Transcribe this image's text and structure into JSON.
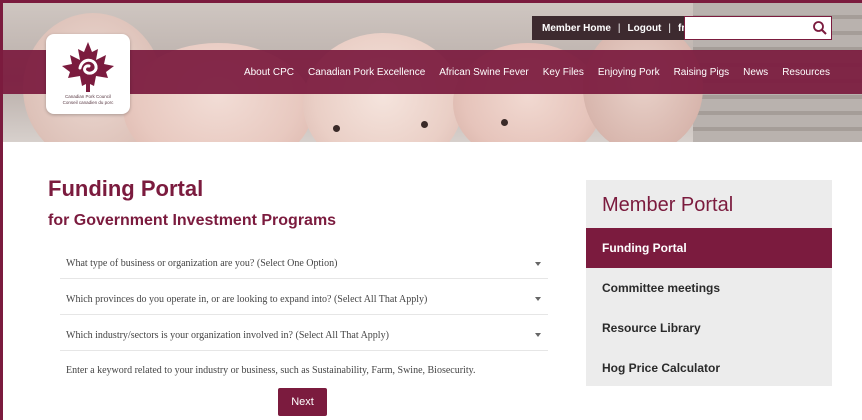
{
  "header": {
    "topbar": {
      "member_home": "Member Home",
      "logout": "Logout",
      "lang": "fr",
      "separator": "|"
    },
    "search": {
      "placeholder": ""
    },
    "logo": {
      "line1": "Canadian Pork Council",
      "line2": "Conseil canadien du porc"
    },
    "nav": [
      {
        "label": "About CPC"
      },
      {
        "label": "Canadian Pork Excellence"
      },
      {
        "label": "African Swine Fever"
      },
      {
        "label": "Key Files"
      },
      {
        "label": "Enjoying Pork"
      },
      {
        "label": "Raising Pigs"
      },
      {
        "label": "News"
      },
      {
        "label": "Resources"
      }
    ]
  },
  "main": {
    "title": "Funding Portal",
    "subtitle": "for Government Investment Programs",
    "questions": [
      {
        "text": "What type of business or organization are you? (Select One Option)"
      },
      {
        "text": "Which provinces do you operate in, or are looking to expand into? (Select All That Apply)"
      },
      {
        "text": "Which industry/sectors is your organization involved in? (Select All That Apply)"
      },
      {
        "text": "Enter a keyword related to your industry or business, such as Sustainability, Farm, Swine, Biosecurity."
      }
    ],
    "next_label": "Next"
  },
  "sidebar": {
    "title": "Member Portal",
    "items": [
      {
        "label": "Funding Portal",
        "active": true
      },
      {
        "label": "Committee meetings",
        "active": false
      },
      {
        "label": "Resource Library",
        "active": false
      },
      {
        "label": "Hog Price Calculator",
        "active": false
      }
    ]
  },
  "colors": {
    "brand": "#7b1b3e",
    "panel_bg": "#ececec",
    "topbar_bg": "#3d2a2f"
  }
}
